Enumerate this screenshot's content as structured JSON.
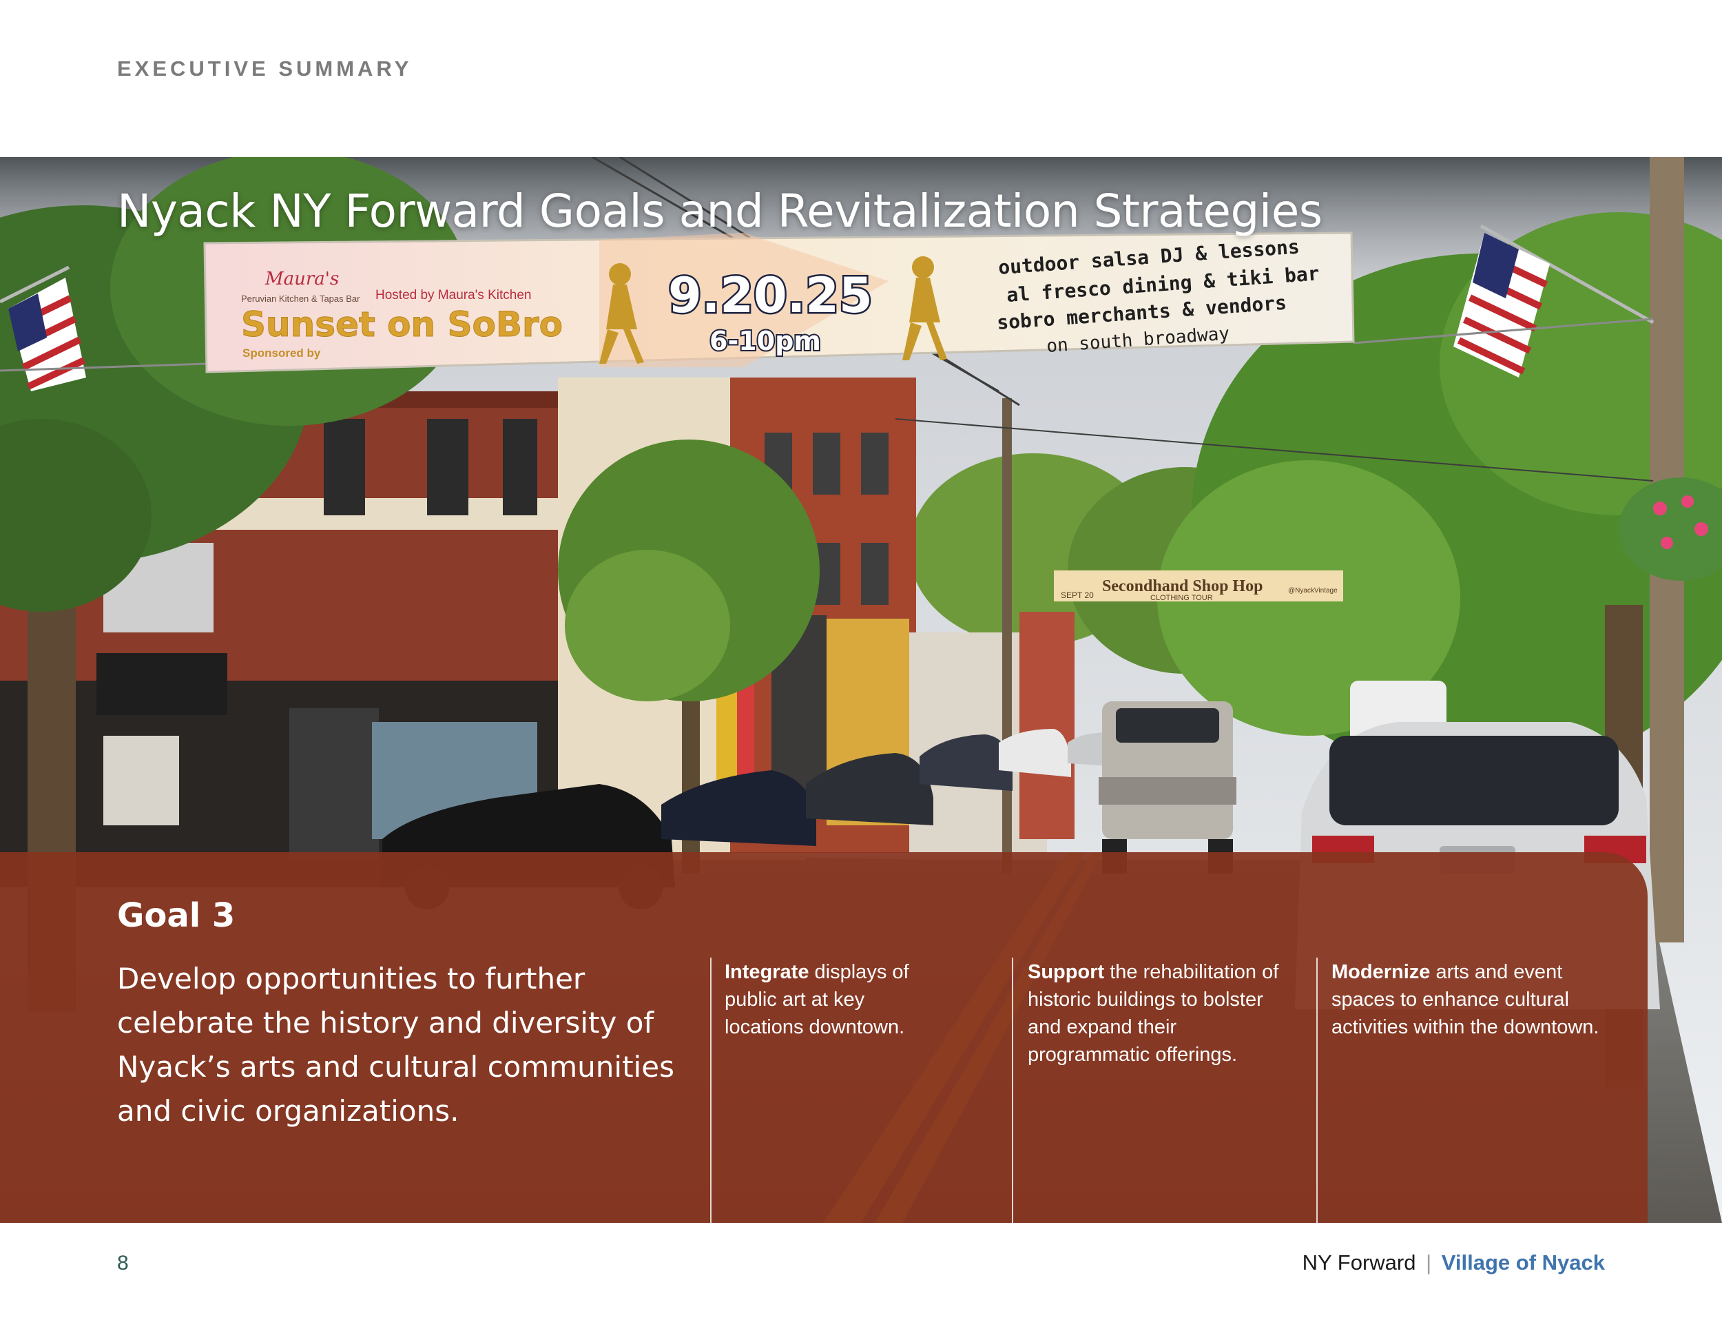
{
  "header": {
    "section_label": "EXECUTIVE SUMMARY"
  },
  "hero": {
    "title": "Nyack NY Forward Goals and Revitalization Strategies",
    "banner": {
      "brand": "Maura's",
      "brand_sub": "Peruvian Kitchen & Tapas Bar",
      "hosted_by": "Hosted by Maura's Kitchen",
      "event_name": "Sunset on SoBro",
      "sponsored_by": "Sponsored by",
      "date": "9.20.25",
      "time": "6-10pm",
      "line1": "outdoor salsa DJ & lessons",
      "line2": "al fresco dining & tiki bar",
      "line3": "sobro merchants & vendors",
      "line4": "on south broadway"
    },
    "far_banner": {
      "title": "Secondhand Shop Hop",
      "date": "SEPT 20",
      "sub": "CLOTHING TOUR",
      "tag": "@NyackVintage"
    }
  },
  "goal": {
    "title": "Goal 3",
    "description": "Develop opportunities to further celebrate the history and diversity of Nyack’s arts and cultural communities and civic organizations.",
    "strategies": [
      {
        "lead": "Integrate",
        "text": " displays of public art at key locations downtown."
      },
      {
        "lead": "Support",
        "text": " the rehabilitation of historic buildings to bolster and expand their programmatic offerings."
      },
      {
        "lead": "Modernize",
        "text": " arts and event spaces to enhance cultural activities within the downtown."
      }
    ]
  },
  "footer": {
    "page_number": "8",
    "program": "NY Forward",
    "separator": "|",
    "village": "Village of Nyack"
  },
  "colors": {
    "panel": "#87341e",
    "label_gray": "#7b7b7b",
    "page_number": "#2e5b53",
    "village_blue": "#3f74ad"
  }
}
